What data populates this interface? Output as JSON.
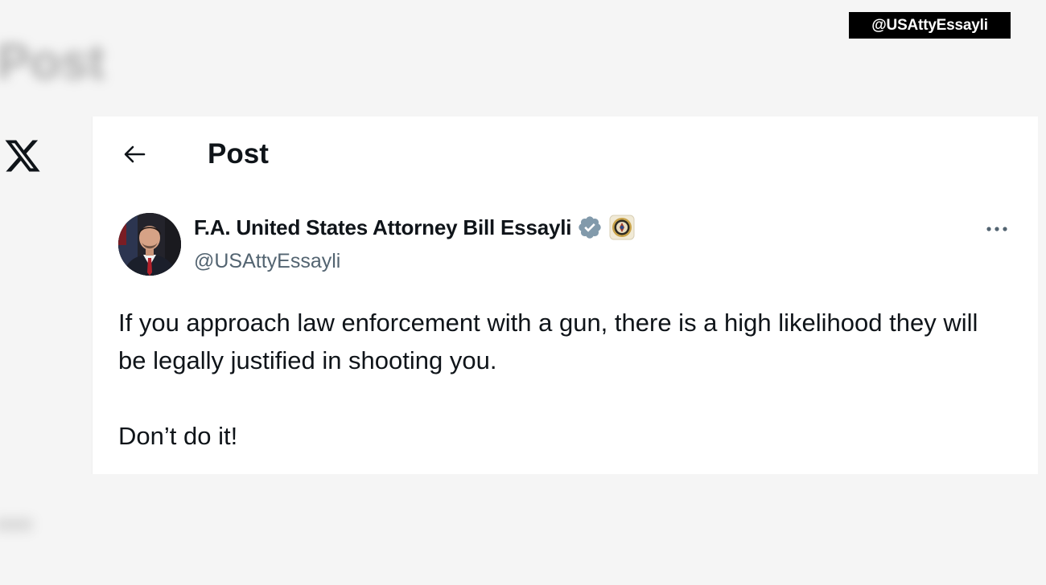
{
  "watermark": {
    "handle": "@USAttyEssayli"
  },
  "background": {
    "blurred_title": "Post"
  },
  "header": {
    "title": "Post",
    "back_icon": "arrow-left-icon"
  },
  "post": {
    "author": {
      "name": "F.A. United States Attorney Bill Essayli",
      "handle": "@USAttyEssayli",
      "verified_icon": "verified-badge-icon",
      "affiliation_icon": "doj-seal-icon"
    },
    "text_line_1": "If you approach law enforcement with a gun, there is a high likelihood they will be legally justified in shooting you.",
    "text_line_2": "Don’t do it!",
    "more_icon": "more-options-icon"
  },
  "colors": {
    "text_primary": "#0f1419",
    "text_secondary": "#536471",
    "verified_badge": "#829aab",
    "watermark_bg": "#000000"
  }
}
